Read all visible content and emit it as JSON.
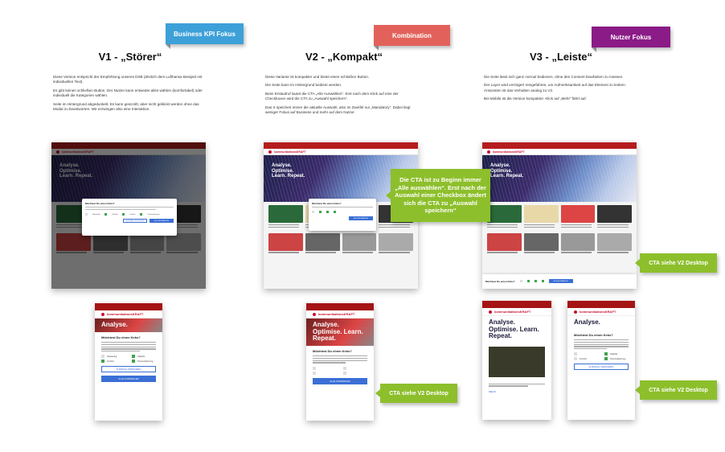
{
  "colors": {
    "kpi_tag": "#3ea0d8",
    "combo_tag": "#e2625b",
    "user_tag": "#8b1b86",
    "note": "#8dbf2c",
    "brand_red": "#b51d1d",
    "cta_blue": "#3b6fd6"
  },
  "columns": [
    {
      "tag": "Business KPI Fokus",
      "title": "V1 - „Störer“",
      "desc": [
        "Diese Version entspricht der Empfehlung unseres DSB (ähnlich dem Lufthansa Beispiel mit individuellen Text).",
        "Es gibt keinen schließen Button. Der Nutzer kann entweder alles wählen (komfortabel) oder individuell die Kategorien wählen.",
        "Seite im Hintergrund abgedunkelt. Es kann gescrollt, aber nicht geklickt werden ohne das Modal zu beantworten. Wir erzwingen also eine Interaktion."
      ]
    },
    {
      "tag": "Kombination",
      "title": "V2 - „Kompakt“",
      "desc": [
        "Diese Variante ist kompakter und bietet einen schließen Button.",
        "Die Seite kann im Hintergrund bedient werden.",
        "Beim Erstaufruf lautet die CTA „Alle Auswählen“. Erst nach dem Klick auf eine der Checkboxen wird die CTA zu „Auswahl speichern“.",
        "Das X speichert immer die aktuelle Auswahl, also im Zweifel nur „Mandatory“. Dabei liegt weniger Fokus auf Business und mehr auf dem Nutzer."
      ]
    },
    {
      "tag": "Nutzer Fokus",
      "title": "V3 - „Leiste“",
      "desc": [
        "Die Seite lässt sich ganz normal bedienen, ohne den Consent bearbeiten zu müssen.",
        "Der Layer wird verzögert reingefahren, um Aufmerksamkeit auf das Element zu lenken. Ansonsten ist das Verhalten analog zu V2.",
        "Bei Mobile ist die Version kompakter. Klick auf „Mehr“ fährt auf."
      ]
    }
  ],
  "mockup": {
    "logo": "kommunikationsKRAFT",
    "hero": "Analyse. Optimise. Learn. Repeat.",
    "modal_title": "Möchtest Du einen Keks?",
    "checks": [
      "Notwendig",
      "Statistik",
      "Komfort",
      "Personalisierung"
    ],
    "btn_save": "AUSWAHL SPEICHERN",
    "btn_all": "ALLE AUSWÄHLEN",
    "more": "MEHR"
  },
  "notes": {
    "cta_main": "Die CTA ist zu Beginn immer „Alle auswählen“. Erst nach der Auswahl einer Checkbox ändert sich die CTA zu „Auswahl speichern“",
    "cta_v2_a": "CTA siehe V2 Desktop",
    "cta_v2_b": "CTA siehe V2 Desktop",
    "cta_v2_c": "CTA siehe V2 Desktop"
  }
}
